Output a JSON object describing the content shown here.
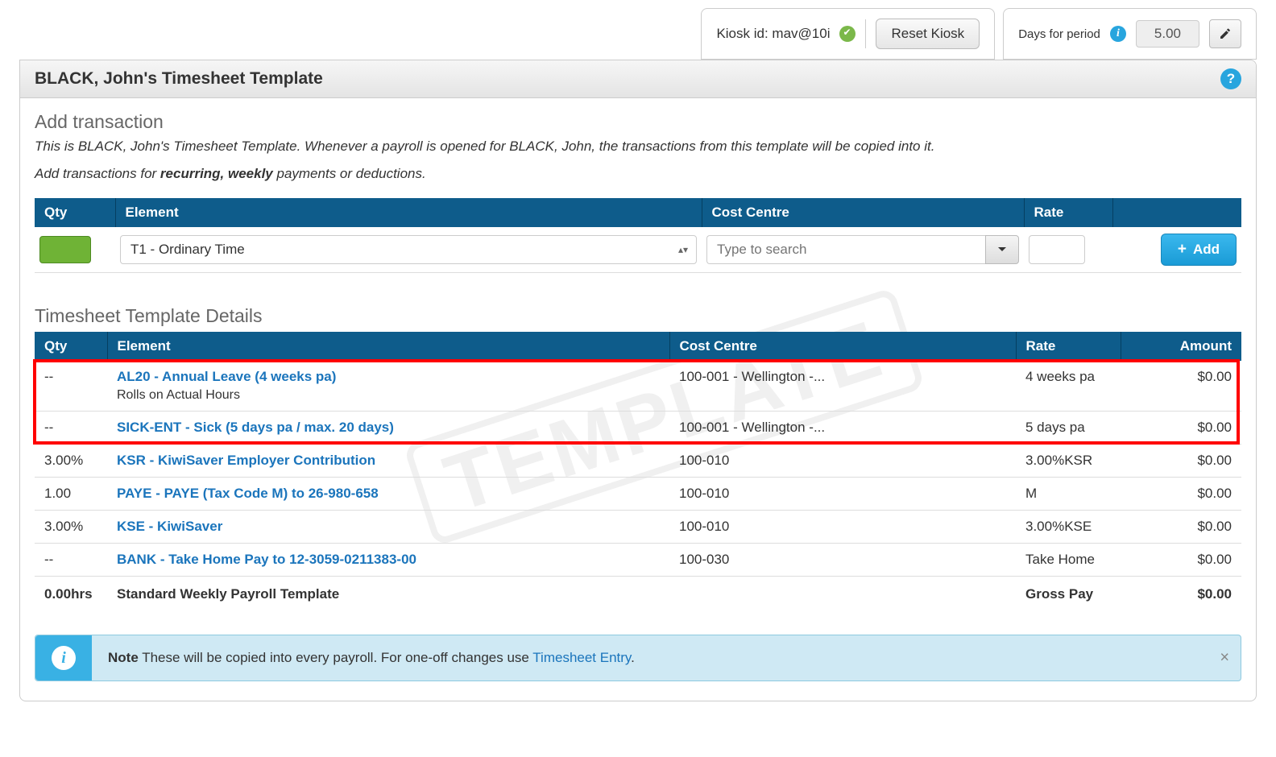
{
  "topbar": {
    "kiosk_label": "Kiosk id:",
    "kiosk_value": "mav@10i",
    "reset_label": "Reset Kiosk",
    "days_label": "Days for period",
    "days_value": "5.00"
  },
  "header": {
    "title": "BLACK, John's Timesheet Template"
  },
  "add_section": {
    "title": "Add transaction",
    "desc_line1_a": "This is BLACK, John's Timesheet Template. Whenever a payroll is opened for BLACK, John, the transactions from this template will be copied into it.",
    "desc_line2_a": "Add transactions for ",
    "desc_line2_b": "recurring, weekly",
    "desc_line2_c": " payments or deductions.",
    "cols": {
      "qty": "Qty",
      "element": "Element",
      "cost": "Cost Centre",
      "rate": "Rate"
    },
    "element_value": "T1 - Ordinary Time",
    "cost_placeholder": "Type to search",
    "add_label": "Add"
  },
  "details": {
    "title": "Timesheet Template Details",
    "cols": {
      "qty": "Qty",
      "element": "Element",
      "cost": "Cost Centre",
      "rate": "Rate",
      "amount": "Amount"
    },
    "rows": [
      {
        "qty": "--",
        "element": "AL20 - Annual Leave (4 weeks pa)",
        "sub": "Rolls on Actual Hours",
        "cost": "100-001 - Wellington -...",
        "rate": "4 weeks pa",
        "amount": "$0.00"
      },
      {
        "qty": "--",
        "element": "SICK-ENT - Sick (5 days pa / max. 20 days)",
        "sub": "",
        "cost": "100-001 - Wellington -...",
        "rate": "5 days pa",
        "amount": "$0.00"
      },
      {
        "qty": "3.00%",
        "element": "KSR - KiwiSaver Employer Contribution",
        "sub": "",
        "cost": "100-010",
        "rate": "3.00%KSR",
        "amount": "$0.00"
      },
      {
        "qty": "1.00",
        "element": "PAYE - PAYE (Tax Code M) to 26-980-658",
        "sub": "",
        "cost": "100-010",
        "rate": "M",
        "amount": "$0.00"
      },
      {
        "qty": "3.00%",
        "element": "KSE - KiwiSaver",
        "sub": "",
        "cost": "100-010",
        "rate": "3.00%KSE",
        "amount": "$0.00"
      },
      {
        "qty": "--",
        "element": "BANK - Take Home Pay to 12-3059-0211383-00",
        "sub": "",
        "cost": "100-030",
        "rate": "Take Home",
        "amount": "$0.00"
      }
    ],
    "footer": {
      "hours": "0.00hrs",
      "label": "Standard Weekly Payroll Template",
      "gross_label": "Gross Pay",
      "gross_value": "$0.00"
    }
  },
  "note": {
    "lead": "Note",
    "text_a": " These will be copied into every payroll. For one-off changes use ",
    "link": "Timesheet Entry",
    "text_b": "."
  },
  "watermark": "TEMPLATE"
}
